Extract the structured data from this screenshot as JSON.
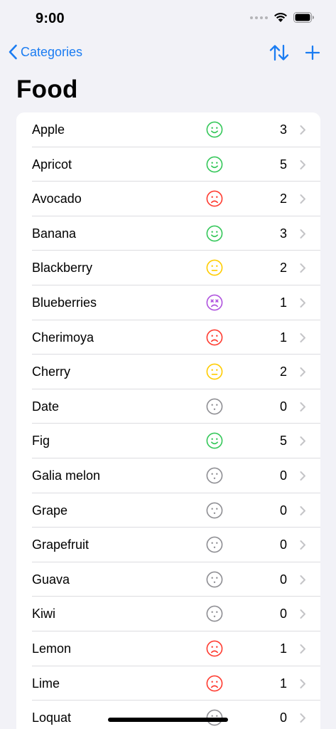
{
  "status": {
    "time": "9:00"
  },
  "nav": {
    "back_label": "Categories",
    "title": "Food"
  },
  "colors": {
    "accent": "#1A7CF2",
    "happy": "#34C759",
    "sad": "#FF3B30",
    "neutral": "#FFCC00",
    "dizzy": "#AF52DE",
    "none": "#8E8E93"
  },
  "items": [
    {
      "label": "Apple",
      "mood": "happy",
      "count": "3"
    },
    {
      "label": "Apricot",
      "mood": "happy",
      "count": "5"
    },
    {
      "label": "Avocado",
      "mood": "sad",
      "count": "2"
    },
    {
      "label": "Banana",
      "mood": "happy",
      "count": "3"
    },
    {
      "label": "Blackberry",
      "mood": "neutral",
      "count": "2"
    },
    {
      "label": "Blueberries",
      "mood": "dizzy",
      "count": "1"
    },
    {
      "label": "Cherimoya",
      "mood": "sad",
      "count": "1"
    },
    {
      "label": "Cherry",
      "mood": "neutral",
      "count": "2"
    },
    {
      "label": "Date",
      "mood": "none",
      "count": "0"
    },
    {
      "label": "Fig",
      "mood": "happy",
      "count": "5"
    },
    {
      "label": "Galia melon",
      "mood": "none",
      "count": "0"
    },
    {
      "label": "Grape",
      "mood": "none",
      "count": "0"
    },
    {
      "label": "Grapefruit",
      "mood": "none",
      "count": "0"
    },
    {
      "label": "Guava",
      "mood": "none",
      "count": "0"
    },
    {
      "label": "Kiwi",
      "mood": "none",
      "count": "0"
    },
    {
      "label": "Lemon",
      "mood": "sad",
      "count": "1"
    },
    {
      "label": "Lime",
      "mood": "sad",
      "count": "1"
    },
    {
      "label": "Loquat",
      "mood": "none",
      "count": "0"
    }
  ]
}
